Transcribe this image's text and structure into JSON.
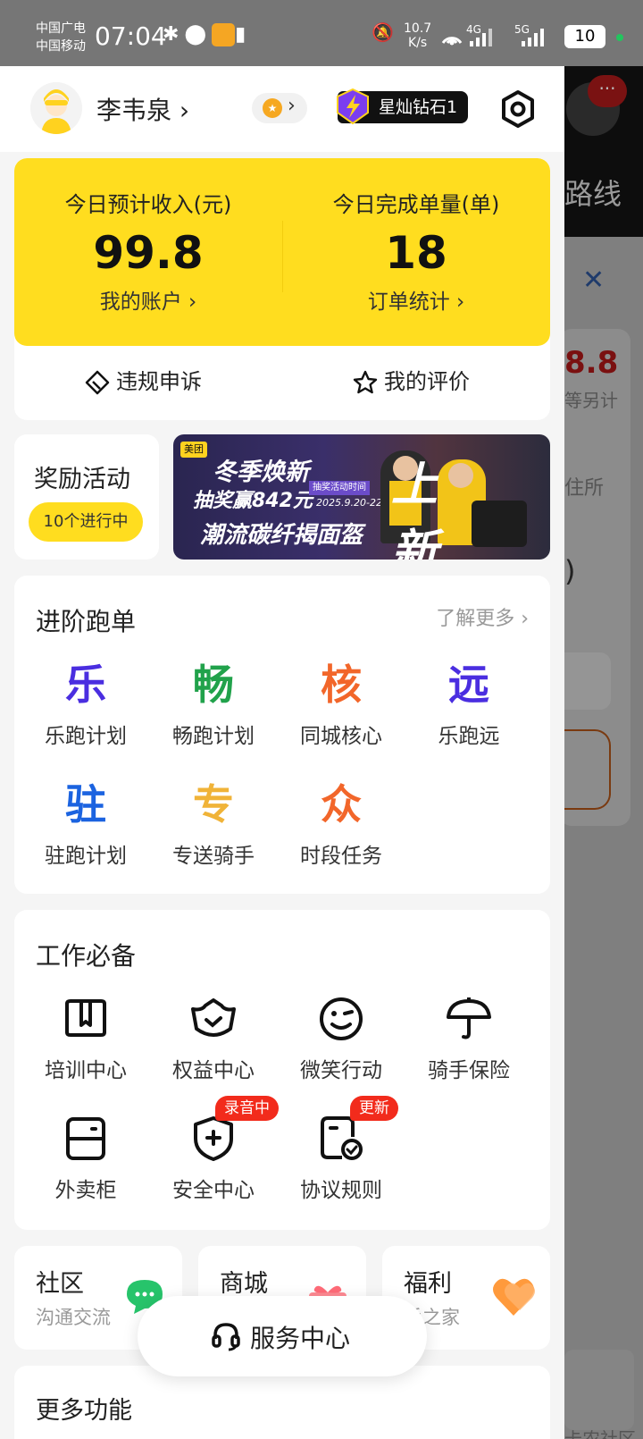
{
  "status_bar": {
    "carrier1": "中国广电",
    "carrier2": "中国移动",
    "time": "07:04",
    "net_speed": "10.7",
    "net_unit": "K/s",
    "signal1": "4G",
    "signal2": "5G",
    "battery": "10"
  },
  "header": {
    "username": "李韦泉",
    "username_chevron": "›",
    "level_badge": "星灿钻石1"
  },
  "income": {
    "left_label": "今日预计收入(元)",
    "left_value": "99.8",
    "left_link": "我的账户 ›",
    "right_label": "今日完成单量(单)",
    "right_value": "18",
    "right_link": "订单统计 ›",
    "action_left": "违规申诉",
    "action_right": "我的评价"
  },
  "reward": {
    "title": "奖励活动",
    "pill": "10个进行中"
  },
  "banner": {
    "brand": "美团",
    "headline1": "冬季焕新",
    "headline2": "抽奖赢842元",
    "headline3": "潮流碳纤揭面盔",
    "tag": "抽奖活动时间",
    "date": "2025.9.20-22",
    "side": "上新"
  },
  "advanced": {
    "title": "进阶跑单",
    "more": "了解更多 ›",
    "items": [
      {
        "glyph": "乐",
        "label": "乐跑计划",
        "color": "#4a2ee0"
      },
      {
        "glyph": "畅",
        "label": "畅跑计划",
        "color": "#21a24b"
      },
      {
        "glyph": "核",
        "label": "同城核心",
        "color": "#f2662a"
      },
      {
        "glyph": "远",
        "label": "乐跑远",
        "color": "#4a2ee0"
      },
      {
        "glyph": "驻",
        "label": "驻跑计划",
        "color": "#1b63e0"
      },
      {
        "glyph": "专",
        "label": "专送骑手",
        "color": "#f0b338"
      },
      {
        "glyph": "众",
        "label": "时段任务",
        "color": "#f2662a"
      }
    ]
  },
  "work": {
    "title": "工作必备",
    "items": [
      {
        "label": "培训中心",
        "icon": "book-icon"
      },
      {
        "label": "权益中心",
        "icon": "crown-icon"
      },
      {
        "label": "微笑行动",
        "icon": "smile-icon"
      },
      {
        "label": "骑手保险",
        "icon": "umbrella-icon"
      },
      {
        "label": "外卖柜",
        "icon": "locker-icon"
      },
      {
        "label": "安全中心",
        "icon": "shield-icon",
        "badge": "录音中"
      },
      {
        "label": "协议规则",
        "icon": "document-icon",
        "badge": "更新"
      }
    ]
  },
  "mini_cards": [
    {
      "title": "社区",
      "sub": "沟通交流"
    },
    {
      "title": "商城",
      "sub": ""
    },
    {
      "title": "福利",
      "sub": "手之家"
    }
  ],
  "service": {
    "label": "服务中心"
  },
  "more_functions": {
    "title": "更多功能"
  },
  "background": {
    "route_text": "路线",
    "amount": "8.8",
    "sub1": "等另计",
    "sub2": "住所",
    "paren": ")",
    "community": "卡农社区"
  }
}
